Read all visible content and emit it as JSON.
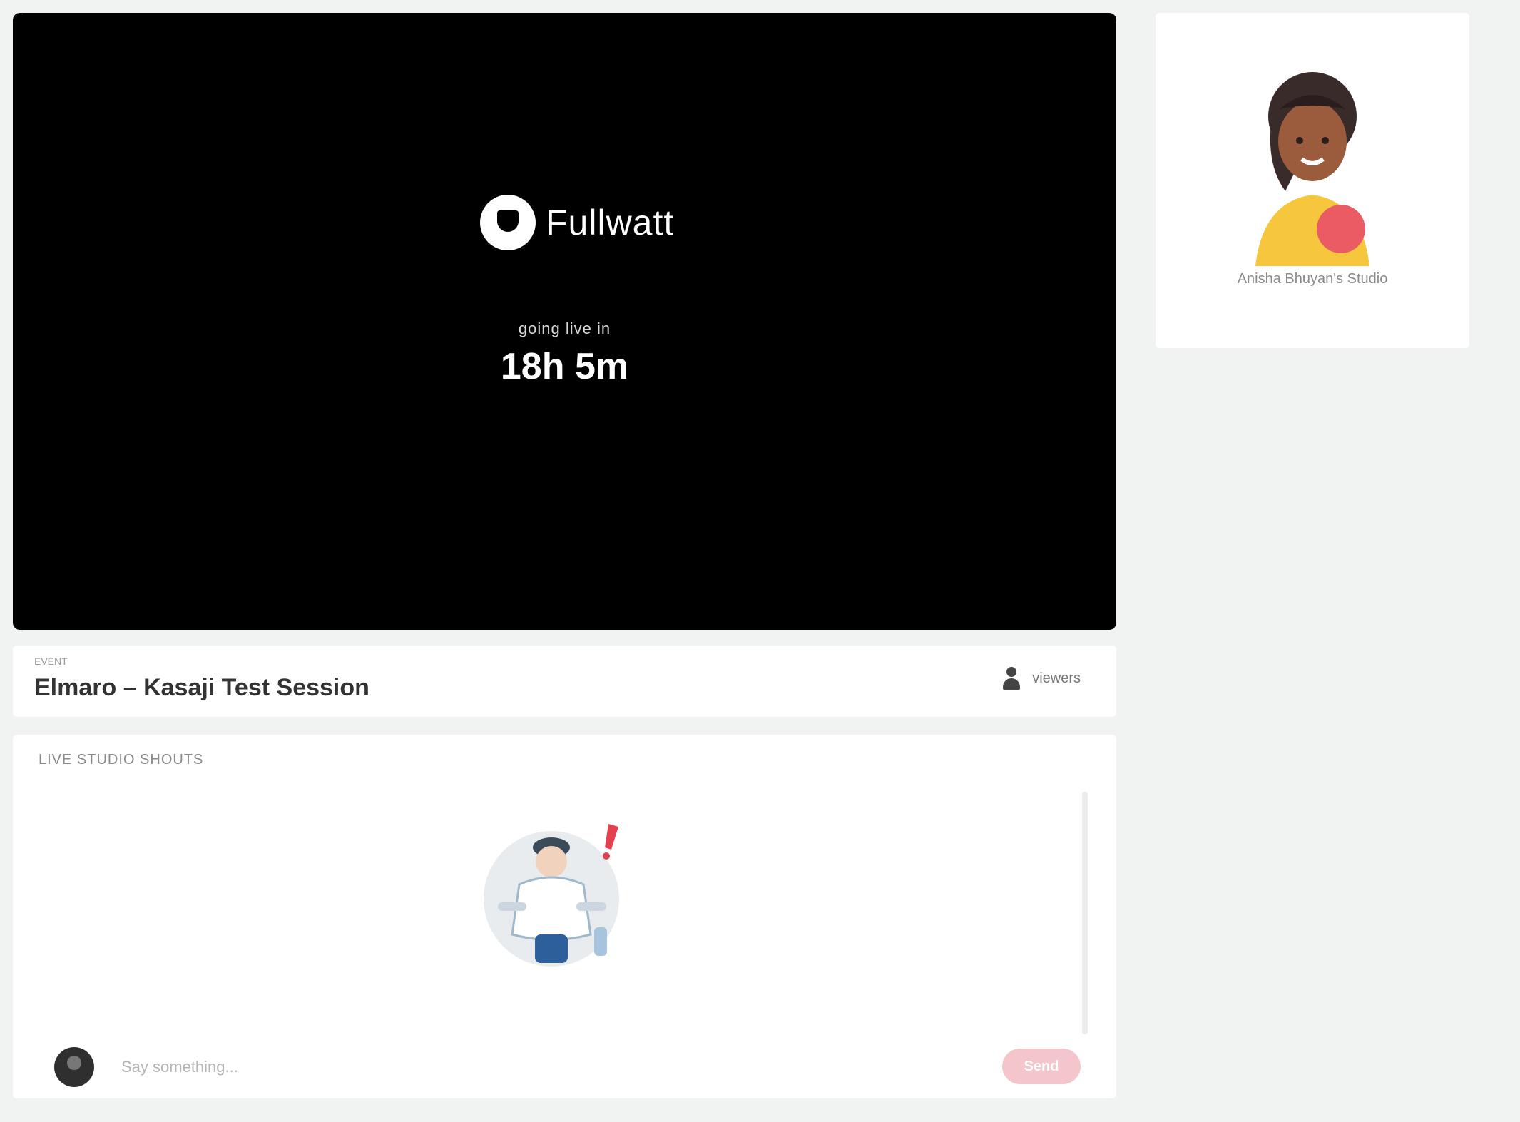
{
  "video": {
    "brand_name": "Fullwatt",
    "countdown_label": "going live in",
    "countdown_value": "18h 5m"
  },
  "event": {
    "kicker": "EVENT",
    "title": "Elmaro – Kasaji Test Session",
    "viewers_label": "viewers"
  },
  "chat": {
    "header": "LIVE STUDIO SHOUTS",
    "input_placeholder": "Say something...",
    "send_label": "Send"
  },
  "host": {
    "name": "Anisha Bhuyan's Studio"
  },
  "colors": {
    "accent": "#f4c6cc",
    "video_bg": "#000000",
    "page_bg": "#f1f2f2"
  }
}
